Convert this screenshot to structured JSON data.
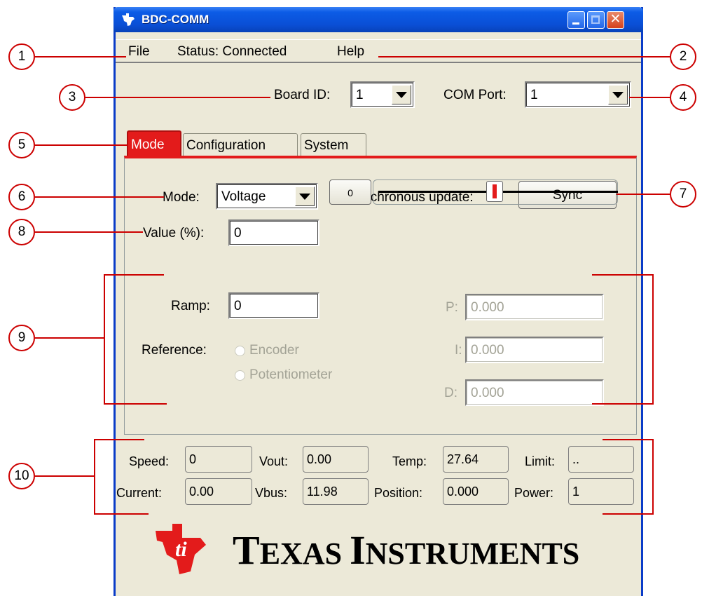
{
  "window": {
    "title": "BDC-COMM"
  },
  "menu": {
    "file": "File",
    "status": "Status: Connected",
    "help": "Help"
  },
  "board": {
    "label": "Board ID:",
    "value": "1"
  },
  "com_port": {
    "label": "COM Port:",
    "value": "1"
  },
  "tabs": [
    "Mode",
    "Configuration",
    "System"
  ],
  "mode": {
    "mode_label": "Mode:",
    "mode_value": "Voltage",
    "sync_label": "Synchronous update:",
    "sync_button": "Sync",
    "value_label": "Value (%):",
    "value": "0",
    "slider_readout": "0",
    "slider_level_percent": 50,
    "ramp_label": "Ramp:",
    "ramp_value": "0",
    "reference_label": "Reference:",
    "reference_options": [
      "Encoder",
      "Potentiometer"
    ],
    "p_label": "P:",
    "p_value": "0.000",
    "i_label": "I:",
    "i_value": "0.000",
    "d_label": "D:",
    "d_value": "0.000"
  },
  "status": {
    "speed_label": "Speed:",
    "speed": "0",
    "vout_label": "Vout:",
    "vout": "0.00",
    "temp_label": "Temp:",
    "temp": "27.64",
    "limit_label": "Limit:",
    "limit": "..",
    "current_label": "Current:",
    "current": "0.00",
    "vbus_label": "Vbus:",
    "vbus": "11.98",
    "position_label": "Position:",
    "position": "0.000",
    "power_label": "Power:",
    "power": "1"
  },
  "logo": {
    "text_big_1": "T",
    "text_small_1": "EXAS ",
    "text_big_2": "I",
    "text_small_2": "NSTRUMENTS"
  },
  "callouts": [
    "1",
    "2",
    "3",
    "4",
    "5",
    "6",
    "7",
    "8",
    "9",
    "10"
  ],
  "colors": {
    "annotation": "#cc0000",
    "accent": "#e31b1b",
    "titlebar": "#0a4fd6",
    "window_bg": "#ece9d8"
  }
}
